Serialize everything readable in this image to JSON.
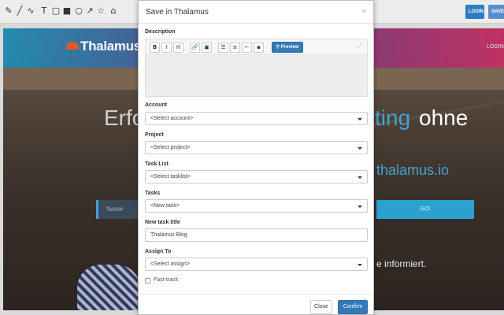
{
  "toolbar": {
    "tools": [
      {
        "icon": "pencil-icon",
        "glyph": "✎"
      },
      {
        "icon": "line-icon",
        "glyph": "╱"
      },
      {
        "icon": "curve-icon",
        "glyph": "∿"
      },
      {
        "icon": "text-icon",
        "glyph": "T"
      },
      {
        "icon": "rectangle-icon",
        "glyph": "▢"
      },
      {
        "icon": "filled-rectangle-icon",
        "glyph": "■"
      },
      {
        "icon": "circle-icon",
        "glyph": "○"
      },
      {
        "icon": "arrow-icon",
        "glyph": "↗"
      },
      {
        "icon": "star-icon",
        "glyph": "☆"
      },
      {
        "icon": "home-icon",
        "glyph": "⌂"
      }
    ],
    "login_label": "LOGIN",
    "save_label": "SAVE"
  },
  "website": {
    "logo_text": "Thalamus",
    "login_link": "LOGIN",
    "hero_left": "Erfo",
    "hero_right_accent": "ting",
    "hero_right": "ohne",
    "hero_domain": "thalamus.io",
    "name_placeholder": "Name",
    "go_label": "GO!",
    "subline": "e informiert."
  },
  "modal": {
    "title": "Save in Thalamus",
    "close_glyph": "×",
    "description": {
      "label": "Description",
      "buttons": [
        "B",
        "I",
        "H",
        "🔗",
        "▣",
        "☰",
        "≡",
        "⌐",
        "▪"
      ],
      "preview_label": "Preview",
      "preview_icon": "search-icon"
    },
    "fields": {
      "account": {
        "label": "Account",
        "value": "<Select account>"
      },
      "project": {
        "label": "Project",
        "value": "<Select project>"
      },
      "tasklist": {
        "label": "Task List",
        "value": "<Select tasklist>"
      },
      "tasks": {
        "label": "Tasks",
        "value": "<New task>"
      },
      "task_title": {
        "label": "New task title",
        "value": "Thalamus Blog"
      },
      "assign": {
        "label": "Assign To",
        "value": "<Select assign>"
      }
    },
    "fast_track_label": "Fast-track",
    "fast_track_checked": false,
    "close_label": "Close",
    "confirm_label": "Confirm"
  },
  "colors": {
    "primary": "#337ab7",
    "accent": "#3fa3d3"
  }
}
